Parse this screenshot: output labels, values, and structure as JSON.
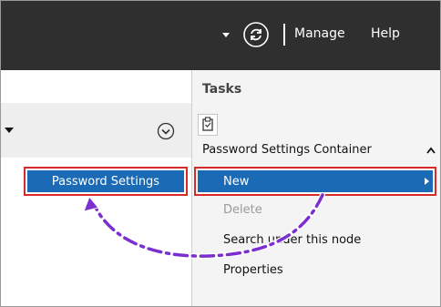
{
  "topbar": {
    "manage_label": "Manage",
    "help_label": "Help"
  },
  "left_pane": {
    "selected_item": "Password Settings"
  },
  "tasks": {
    "title": "Tasks",
    "container_label": "Password Settings Container",
    "items": [
      {
        "label": "New",
        "state": "highlighted"
      },
      {
        "label": "Delete",
        "state": "disabled"
      },
      {
        "label": "Search under this node",
        "state": "normal"
      },
      {
        "label": "Properties",
        "state": "normal"
      }
    ]
  },
  "colors": {
    "topbar_bg": "#2f2f2f",
    "highlight_blue": "#1b6ab5",
    "callout_red": "#d52b2b",
    "arrow_purple": "#7b2fd0"
  },
  "icons": {
    "refresh": "refresh-icon",
    "dropdown": "dropdown-arrow-icon",
    "chevron": "chevron-down-circle-icon",
    "clipboard": "clipboard-icon",
    "collapse": "chevron-up-icon",
    "submenu": "submenu-arrow-icon"
  }
}
